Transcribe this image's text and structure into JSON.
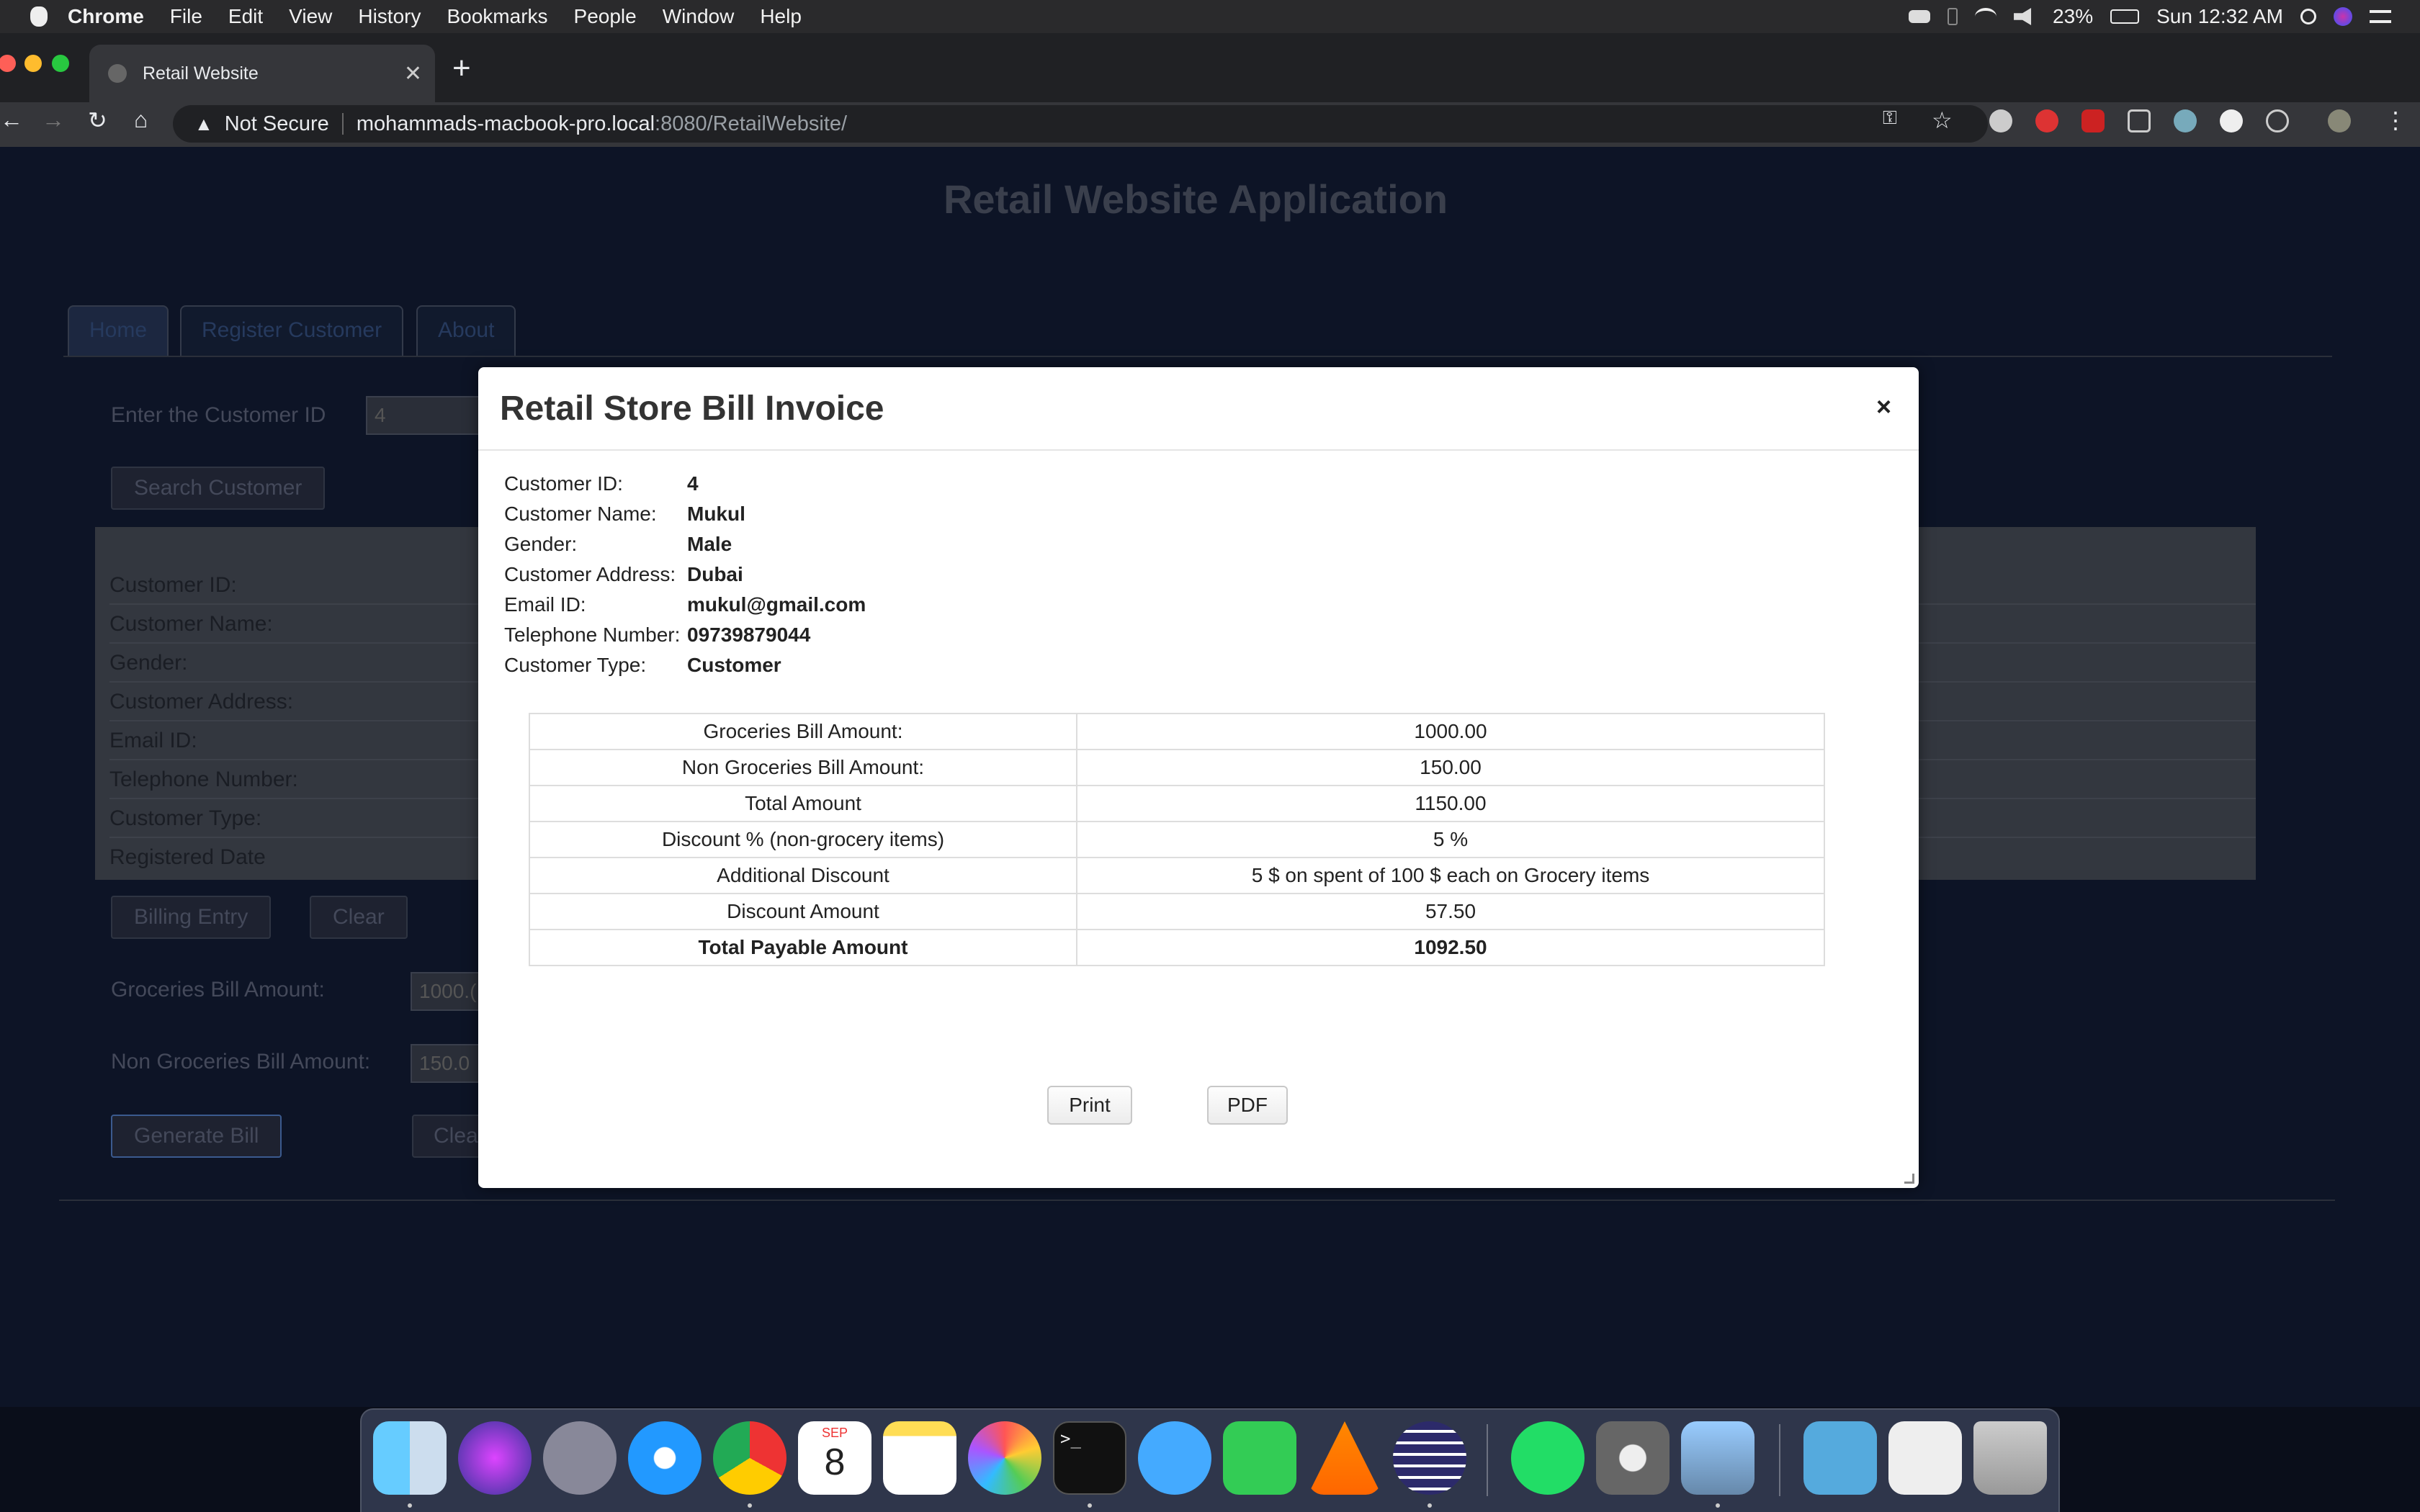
{
  "menubar": {
    "app": "Chrome",
    "items": [
      "File",
      "Edit",
      "View",
      "History",
      "Bookmarks",
      "People",
      "Window",
      "Help"
    ],
    "battery": "23%",
    "clock": "Sun 12:32 AM"
  },
  "browser": {
    "tab_title": "Retail Website",
    "security": "Not Secure",
    "url_host": "mohammads-macbook-pro.local",
    "url_path": ":8080/RetailWebsite/"
  },
  "page": {
    "title": "Retail Website Application",
    "tabs": [
      "Home",
      "Register Customer",
      "About"
    ],
    "customer_id_label": "Enter the Customer ID",
    "customer_id_value": "4",
    "search_button": "Search Customer",
    "info_labels": [
      "Customer ID:",
      "Customer Name:",
      "Gender:",
      "Customer Address:",
      "Email ID:",
      "Telephone Number:",
      "Customer Type:",
      "Registered Date"
    ],
    "billing_entry_button": "Billing Entry",
    "clear_button": "Clear",
    "groceries_label": "Groceries Bill Amount:",
    "groceries_value": "1000.(",
    "non_groceries_label": "Non Groceries Bill Amount:",
    "non_groceries_value": "150.0",
    "generate_bill_button": "Generate Bill",
    "clear_button_2": "Clea"
  },
  "modal": {
    "title": "Retail Store Bill Invoice",
    "close": "×",
    "details": [
      {
        "label": "Customer ID:",
        "value": "4"
      },
      {
        "label": "Customer Name:",
        "value": "Mukul"
      },
      {
        "label": "Gender:",
        "value": "Male"
      },
      {
        "label": "Customer Address:",
        "value": "Dubai"
      },
      {
        "label": "Email ID:",
        "value": "mukul@gmail.com"
      },
      {
        "label": "Telephone Number:",
        "value": "09739879044"
      },
      {
        "label": "Customer Type:",
        "value": "Customer"
      }
    ],
    "bill": [
      {
        "label": "Groceries Bill Amount:",
        "value": "1000.00"
      },
      {
        "label": "Non Groceries Bill Amount:",
        "value": "150.00"
      },
      {
        "label": "Total Amount",
        "value": "1150.00"
      },
      {
        "label": "Discount % (non-grocery items)",
        "value": "5 %"
      },
      {
        "label": "Additional Discount",
        "value": "5 $ on spent of 100 $ each on Grocery items"
      },
      {
        "label": "Discount Amount",
        "value": "57.50"
      },
      {
        "label": "Total Payable Amount",
        "value": "1092.50"
      }
    ],
    "print_button": "Print",
    "pdf_button": "PDF"
  },
  "dock": {
    "calendar_month": "SEP",
    "calendar_day": "8"
  },
  "colors": {
    "page_bg": "#0d1426",
    "modal_bg": "#ffffff",
    "tab_active_text": "#263a5e"
  }
}
